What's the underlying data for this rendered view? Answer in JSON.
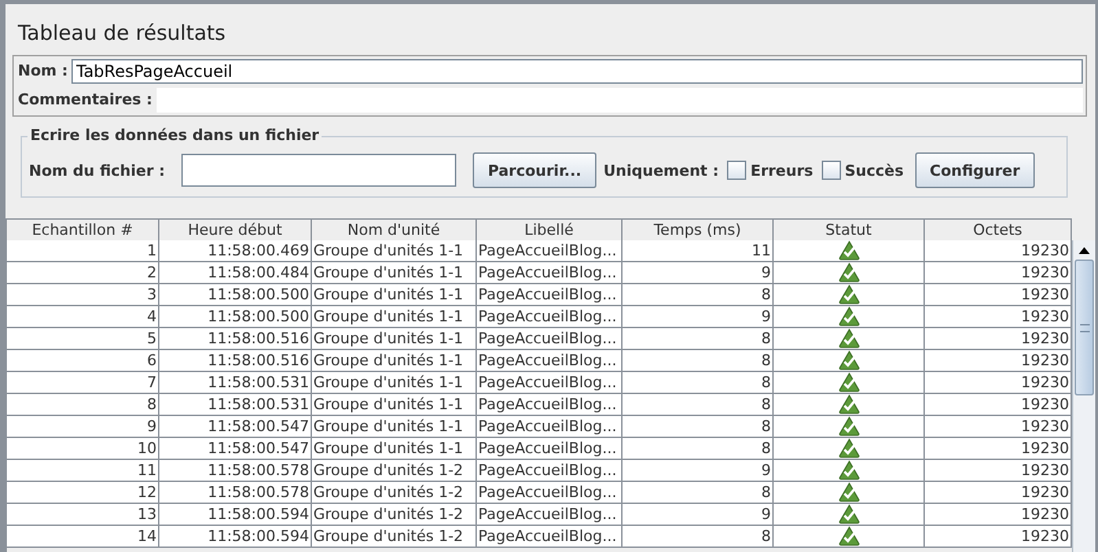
{
  "title": "Tableau de résultats",
  "name_field": {
    "label": "Nom :",
    "value": "TabResPageAccueil"
  },
  "comments_field": {
    "label": "Commentaires :"
  },
  "file_group": {
    "legend": "Ecrire les données dans un fichier",
    "file_label": "Nom du fichier :",
    "browse_button": "Parcourir...",
    "only_label": "Uniquement :",
    "checkboxes": [
      {
        "label": "Erreurs",
        "checked": false
      },
      {
        "label": "Succès",
        "checked": false
      }
    ],
    "configure_button": "Configurer"
  },
  "table": {
    "columns": [
      "Echantillon #",
      "Heure début",
      "Nom d'unité",
      "Libellé",
      "Temps (ms)",
      "Statut",
      "Octets"
    ],
    "rows": [
      {
        "sample": "1",
        "start": "11:58:00.469",
        "unit": "Groupe d'unités 1-1",
        "label": "PageAccueilBlog...",
        "time": "11",
        "success": true,
        "bytes": "19230"
      },
      {
        "sample": "2",
        "start": "11:58:00.484",
        "unit": "Groupe d'unités 1-1",
        "label": "PageAccueilBlog...",
        "time": "9",
        "success": true,
        "bytes": "19230"
      },
      {
        "sample": "3",
        "start": "11:58:00.500",
        "unit": "Groupe d'unités 1-1",
        "label": "PageAccueilBlog...",
        "time": "8",
        "success": true,
        "bytes": "19230"
      },
      {
        "sample": "4",
        "start": "11:58:00.500",
        "unit": "Groupe d'unités 1-1",
        "label": "PageAccueilBlog...",
        "time": "9",
        "success": true,
        "bytes": "19230"
      },
      {
        "sample": "5",
        "start": "11:58:00.516",
        "unit": "Groupe d'unités 1-1",
        "label": "PageAccueilBlog...",
        "time": "8",
        "success": true,
        "bytes": "19230"
      },
      {
        "sample": "6",
        "start": "11:58:00.516",
        "unit": "Groupe d'unités 1-1",
        "label": "PageAccueilBlog...",
        "time": "8",
        "success": true,
        "bytes": "19230"
      },
      {
        "sample": "7",
        "start": "11:58:00.531",
        "unit": "Groupe d'unités 1-1",
        "label": "PageAccueilBlog...",
        "time": "8",
        "success": true,
        "bytes": "19230"
      },
      {
        "sample": "8",
        "start": "11:58:00.531",
        "unit": "Groupe d'unités 1-1",
        "label": "PageAccueilBlog...",
        "time": "8",
        "success": true,
        "bytes": "19230"
      },
      {
        "sample": "9",
        "start": "11:58:00.547",
        "unit": "Groupe d'unités 1-1",
        "label": "PageAccueilBlog...",
        "time": "8",
        "success": true,
        "bytes": "19230"
      },
      {
        "sample": "10",
        "start": "11:58:00.547",
        "unit": "Groupe d'unités 1-1",
        "label": "PageAccueilBlog...",
        "time": "8",
        "success": true,
        "bytes": "19230"
      },
      {
        "sample": "11",
        "start": "11:58:00.578",
        "unit": "Groupe d'unités 1-2",
        "label": "PageAccueilBlog...",
        "time": "9",
        "success": true,
        "bytes": "19230"
      },
      {
        "sample": "12",
        "start": "11:58:00.578",
        "unit": "Groupe d'unités 1-2",
        "label": "PageAccueilBlog...",
        "time": "8",
        "success": true,
        "bytes": "19230"
      },
      {
        "sample": "13",
        "start": "11:58:00.594",
        "unit": "Groupe d'unités 1-2",
        "label": "PageAccueilBlog...",
        "time": "9",
        "success": true,
        "bytes": "19230"
      },
      {
        "sample": "14",
        "start": "11:58:00.594",
        "unit": "Groupe d'unités 1-2",
        "label": "PageAccueilBlog...",
        "time": "8",
        "success": true,
        "bytes": "19230"
      }
    ]
  }
}
